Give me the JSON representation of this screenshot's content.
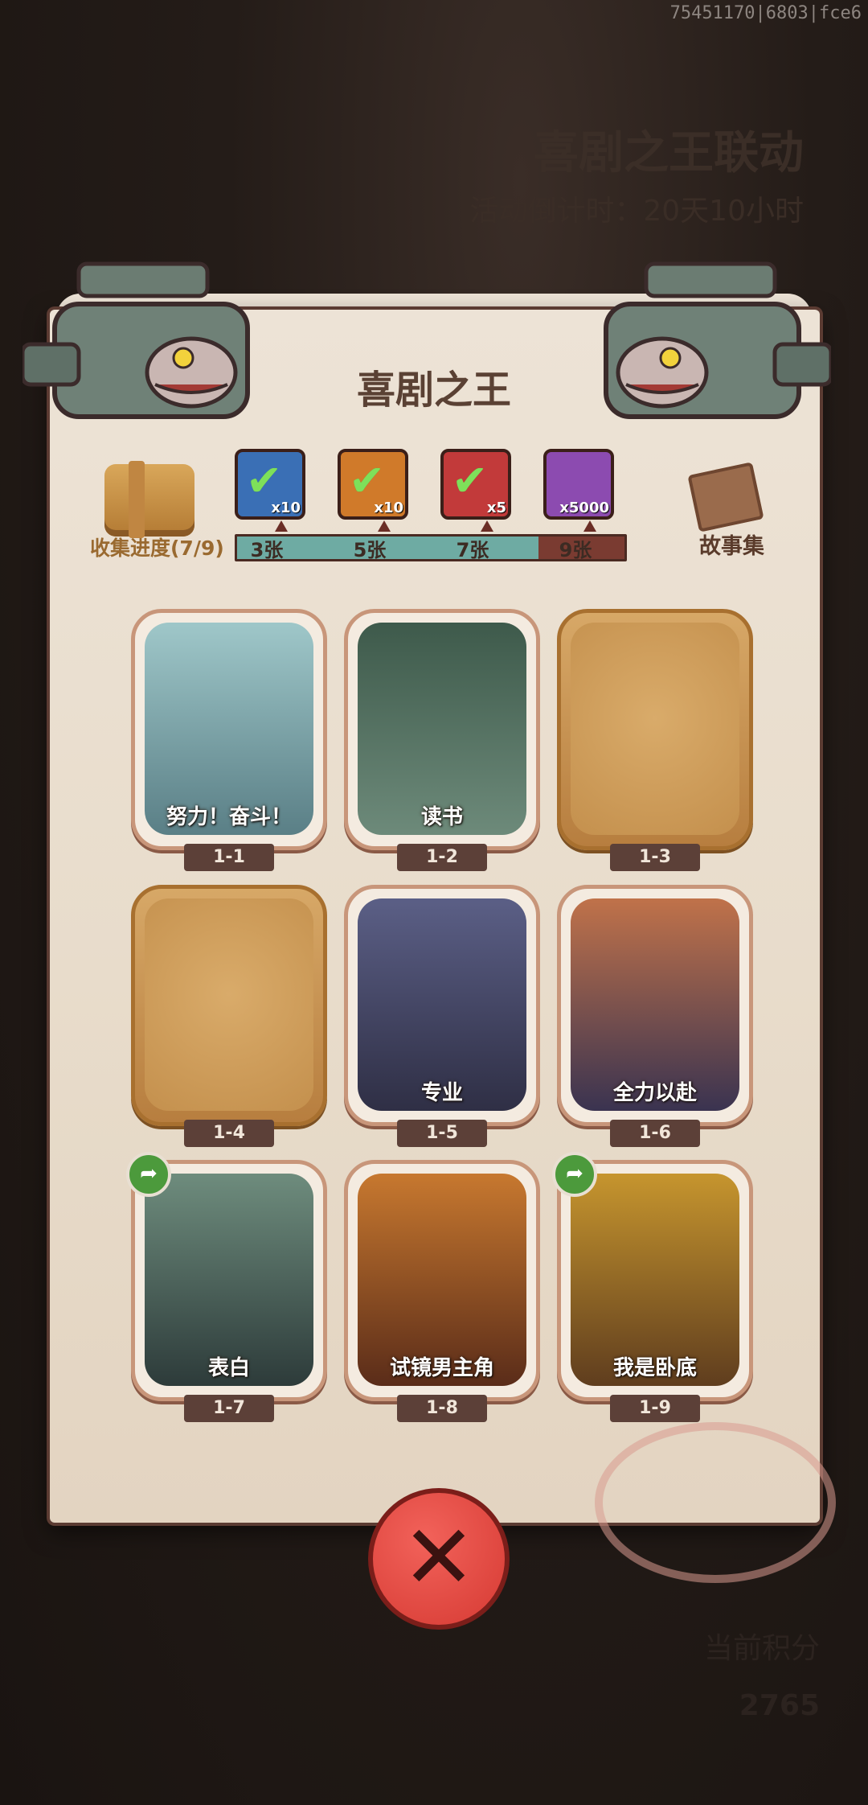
{
  "watermark": "75451170|6803|fce6",
  "background": {
    "event_title": "喜剧之王联动",
    "countdown": "活动倒计时：20天10小时",
    "bottom_text_1": "当前积分",
    "bottom_value": "2765"
  },
  "panel": {
    "title": "喜剧之王",
    "collect_label": "收集进度(7/9)",
    "collected": 7,
    "total": 9,
    "storybook_label": "故事集",
    "milestones": [
      {
        "label": "3张",
        "reward_icon": "treasure-chest-icon",
        "qty": "x10",
        "claimed": true,
        "color": "#3a6fb5"
      },
      {
        "label": "5张",
        "reward_icon": "scroll-icon",
        "qty": "x10",
        "claimed": true,
        "color": "#d07a2a"
      },
      {
        "label": "7张",
        "reward_icon": "orb-icon",
        "qty": "x5",
        "claimed": true,
        "color": "#c23a3a"
      },
      {
        "label": "9张",
        "reward_icon": "crystal-icon",
        "qty": "x5000",
        "claimed": false,
        "color": "#8c4bb0"
      }
    ]
  },
  "cards": [
    {
      "id": "1-1",
      "title": "努力！奋斗！",
      "locked": false,
      "share": false
    },
    {
      "id": "1-2",
      "title": "读书",
      "locked": false,
      "share": false
    },
    {
      "id": "1-3",
      "title": "",
      "locked": true,
      "share": false
    },
    {
      "id": "1-4",
      "title": "",
      "locked": true,
      "share": false
    },
    {
      "id": "1-5",
      "title": "专业",
      "locked": false,
      "share": false
    },
    {
      "id": "1-6",
      "title": "全力以赴",
      "locked": false,
      "share": false
    },
    {
      "id": "1-7",
      "title": "表白",
      "locked": false,
      "share": true
    },
    {
      "id": "1-8",
      "title": "试镜男主角",
      "locked": false,
      "share": false
    },
    {
      "id": "1-9",
      "title": "我是卧底",
      "locked": false,
      "share": true
    }
  ],
  "close_icon": "close-icon"
}
